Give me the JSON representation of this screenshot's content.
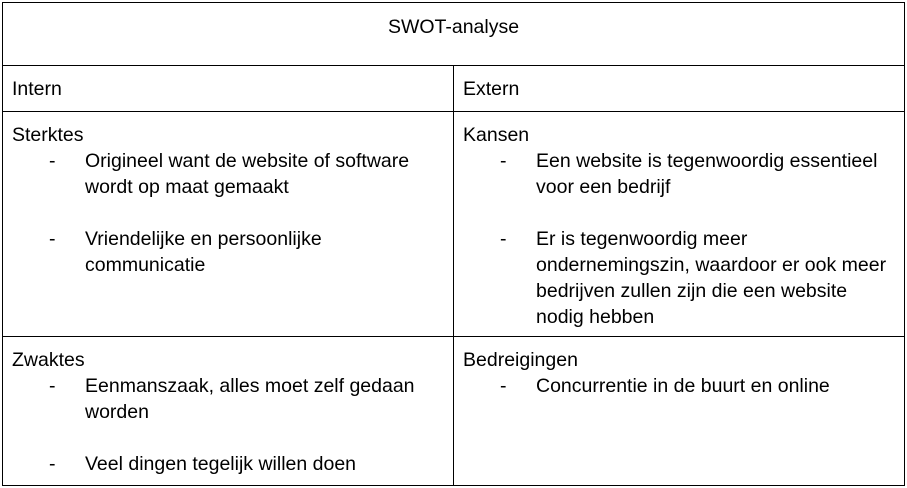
{
  "document": {
    "title": "SWOT-analyse",
    "columns": [
      "Intern",
      "Extern"
    ],
    "quadrants": {
      "strengths": {
        "heading": "Sterktes",
        "bullets": [
          "Origineel want de website of software wordt op maat gemaakt",
          "Vriendelijke en persoonlijke communicatie"
        ]
      },
      "opportunities": {
        "heading": "Kansen",
        "bullets": [
          "Een website is tegenwoordig essentieel voor een bedrijf",
          "Er is tegenwoordig meer ondernemingszin, waardoor er ook meer bedrijven zullen zijn die een website nodig hebben"
        ]
      },
      "weaknesses": {
        "heading": "Zwaktes",
        "bullets": [
          "Eenmanszaak, alles moet zelf gedaan worden",
          "Veel dingen tegelijk willen doen"
        ]
      },
      "threats": {
        "heading": "Bedreigingen",
        "bullets": [
          "Concurrentie in de buurt en online"
        ]
      }
    },
    "bullet_marker": "-"
  }
}
